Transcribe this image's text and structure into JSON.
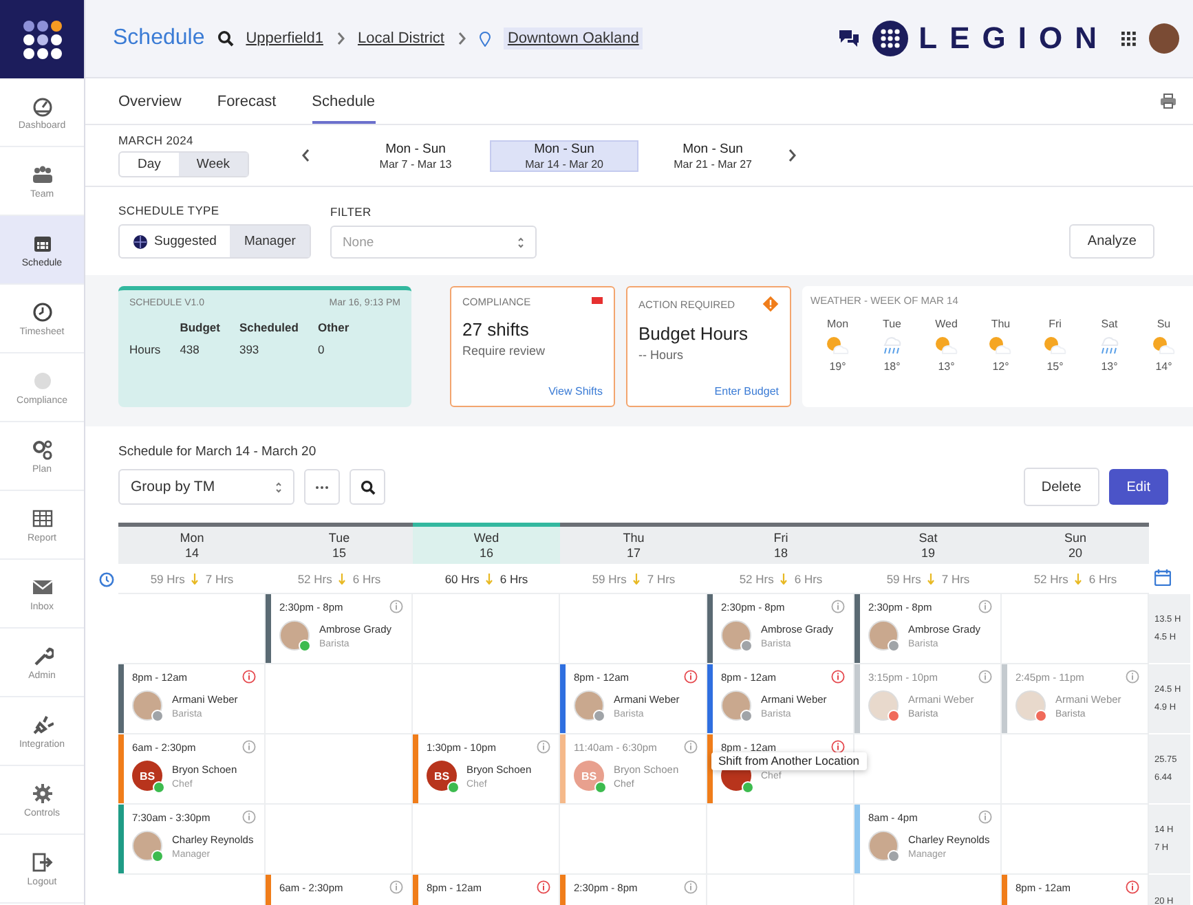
{
  "sidebar": {
    "items": [
      {
        "label": "Dashboard",
        "selected": false,
        "disabled": false
      },
      {
        "label": "Team",
        "selected": false,
        "disabled": false
      },
      {
        "label": "Schedule",
        "selected": true,
        "disabled": false
      },
      {
        "label": "Timesheet",
        "selected": false,
        "disabled": false
      },
      {
        "label": "Compliance",
        "selected": false,
        "disabled": true
      },
      {
        "label": "Plan",
        "selected": false,
        "disabled": false
      },
      {
        "label": "Report",
        "selected": false,
        "disabled": false
      },
      {
        "label": "Inbox",
        "selected": false,
        "disabled": false
      },
      {
        "label": "Admin",
        "selected": false,
        "disabled": false
      },
      {
        "label": "Integration",
        "selected": false,
        "disabled": false
      },
      {
        "label": "Controls",
        "selected": false,
        "disabled": false
      },
      {
        "label": "Logout",
        "selected": false,
        "disabled": false
      }
    ]
  },
  "topbar": {
    "title": "Schedule",
    "breadcrumbs": [
      "Upperfield1",
      "Local District",
      "Downtown Oakland"
    ],
    "logo": "LEGION"
  },
  "tabs": [
    {
      "label": "Overview",
      "selected": false
    },
    {
      "label": "Forecast",
      "selected": false
    },
    {
      "label": "Schedule",
      "selected": true
    }
  ],
  "period": {
    "label": "MARCH 2024",
    "views": [
      {
        "label": "Day",
        "selected": false
      },
      {
        "label": "Week",
        "selected": true
      }
    ],
    "weeks": [
      {
        "title": "Mon - Sun",
        "range": "Mar 7 - Mar 13",
        "selected": false
      },
      {
        "title": "Mon - Sun",
        "range": "Mar 14 - Mar 20",
        "selected": true
      },
      {
        "title": "Mon - Sun",
        "range": "Mar 21 - Mar 27",
        "selected": false
      }
    ]
  },
  "schedule_type": {
    "label": "SCHEDULE TYPE",
    "options": [
      {
        "label": "Suggested",
        "selected": false
      },
      {
        "label": "Manager",
        "selected": true
      }
    ]
  },
  "filter": {
    "label": "FILTER",
    "value": "None"
  },
  "analyze_button": "Analyze",
  "summary": {
    "title": "SCHEDULE V1.0",
    "timestamp": "Mar 16, 9:13 PM",
    "columns": [
      "Budget",
      "Scheduled",
      "Other"
    ],
    "row_label": "Hours",
    "values": [
      "438",
      "393",
      "0"
    ]
  },
  "compliance": {
    "label": "COMPLIANCE",
    "headline": "27 shifts",
    "detail": "Require review",
    "link": "View Shifts"
  },
  "action": {
    "label": "ACTION REQUIRED",
    "headline": "Budget Hours",
    "detail": "-- Hours",
    "link": "Enter Budget"
  },
  "weather": {
    "title": "WEATHER - WEEK OF MAR 14",
    "days": [
      {
        "day": "Mon",
        "kind": "sunny",
        "temp": "19°"
      },
      {
        "day": "Tue",
        "kind": "rain",
        "temp": "18°"
      },
      {
        "day": "Wed",
        "kind": "sunny",
        "temp": "13°"
      },
      {
        "day": "Thu",
        "kind": "sunny",
        "temp": "12°"
      },
      {
        "day": "Fri",
        "kind": "sunny",
        "temp": "15°"
      },
      {
        "day": "Sat",
        "kind": "rain",
        "temp": "13°"
      },
      {
        "day": "Su",
        "kind": "sunny",
        "temp": "14°"
      }
    ]
  },
  "schedule": {
    "title": "Schedule for March 14 - March 20",
    "group_by": "Group by TM",
    "delete_button": "Delete",
    "edit_button": "Edit",
    "days": [
      {
        "day": "Mon",
        "date": "14",
        "hours": "59 Hrs",
        "diff": "7 Hrs",
        "selected": false
      },
      {
        "day": "Tue",
        "date": "15",
        "hours": "52 Hrs",
        "diff": "6 Hrs",
        "selected": false
      },
      {
        "day": "Wed",
        "date": "16",
        "hours": "60 Hrs",
        "diff": "6 Hrs",
        "selected": true
      },
      {
        "day": "Thu",
        "date": "17",
        "hours": "59 Hrs",
        "diff": "7 Hrs",
        "selected": false
      },
      {
        "day": "Fri",
        "date": "18",
        "hours": "52 Hrs",
        "diff": "6 Hrs",
        "selected": false
      },
      {
        "day": "Sat",
        "date": "19",
        "hours": "59 Hrs",
        "diff": "7 Hrs",
        "selected": false
      },
      {
        "day": "Sun",
        "date": "20",
        "hours": "52 Hrs",
        "diff": "6 Hrs",
        "selected": false
      }
    ],
    "rows": [
      {
        "totals": [
          "13.5 H",
          "4.5 H"
        ],
        "cells": [
          {
            "kind": "empty"
          },
          {
            "kind": "shift",
            "time": "2:30pm - 8pm",
            "name": "Ambrose Grady",
            "role": "Barista",
            "monogram": false,
            "color": "#5a6a73",
            "status": {
              "color": "#3dbb4f"
            },
            "faded": false,
            "alert": false
          },
          {
            "kind": "empty"
          },
          {
            "kind": "empty"
          },
          {
            "kind": "shift",
            "time": "2:30pm - 8pm",
            "name": "Ambrose Grady",
            "role": "Barista",
            "monogram": false,
            "color": "#5a6a73",
            "status": {
              "color": "#a0a4a8"
            },
            "faded": false,
            "alert": false
          },
          {
            "kind": "shift",
            "time": "2:30pm - 8pm",
            "name": "Ambrose Grady",
            "role": "Barista",
            "monogram": false,
            "color": "#5a6a73",
            "status": {
              "color": "#a0a4a8"
            },
            "faded": false,
            "alert": false
          },
          {
            "kind": "empty"
          }
        ]
      },
      {
        "totals": [
          "24.5 H",
          "4.9 H"
        ],
        "cells": [
          {
            "kind": "shift",
            "time": "8pm - 12am",
            "name": "Armani Weber",
            "role": "Barista",
            "monogram": false,
            "color": "#5a6a73",
            "status": {
              "color": "#a0a4a8"
            },
            "faded": false,
            "alert": true
          },
          {
            "kind": "empty"
          },
          {
            "kind": "empty"
          },
          {
            "kind": "shift",
            "time": "8pm - 12am",
            "name": "Armani Weber",
            "role": "Barista",
            "monogram": false,
            "color": "#2f6fe0",
            "status": {
              "color": "#a0a4a8"
            },
            "faded": false,
            "alert": true
          },
          {
            "kind": "shift",
            "time": "8pm - 12am",
            "name": "Armani Weber",
            "role": "Barista",
            "monogram": false,
            "color": "#2f6fe0",
            "status": {
              "color": "#a0a4a8"
            },
            "faded": false,
            "alert": true
          },
          {
            "kind": "shift",
            "time": "3:15pm - 10pm",
            "name": "Armani Weber",
            "role": "Barista",
            "monogram": false,
            "color": "#c4cacf",
            "status": {
              "color": "#f06a5a"
            },
            "faded": true,
            "alert": false
          },
          {
            "kind": "shift",
            "time": "2:45pm - 11pm",
            "name": "Armani Weber",
            "role": "Barista",
            "monogram": false,
            "color": "#c4cacf",
            "status": {
              "color": "#f06a5a"
            },
            "faded": true,
            "alert": false
          }
        ]
      },
      {
        "totals": [
          "25.75",
          "6.44"
        ],
        "cells": [
          {
            "kind": "shift",
            "time": "6am - 2:30pm",
            "name": "Bryon Schoen",
            "role": "Chef",
            "monogram": true,
            "initials": "BS",
            "color": "#f07d1a",
            "status": {
              "color": "#3dbb4f"
            },
            "faded": false,
            "alert": false
          },
          {
            "kind": "empty"
          },
          {
            "kind": "shift",
            "time": "1:30pm - 10pm",
            "name": "Bryon Schoen",
            "role": "Chef",
            "monogram": true,
            "initials": "BS",
            "color": "#f07d1a",
            "status": {
              "color": "#3dbb4f"
            },
            "faded": false,
            "alert": false
          },
          {
            "kind": "shift",
            "time": "11:40am - 6:30pm",
            "name": "Bryon Schoen",
            "role": "Chef",
            "monogram": true,
            "initials": "BS",
            "color": "#f5b98a",
            "status": {
              "color": "#3dbb4f"
            },
            "faded": true,
            "alert": false
          },
          {
            "kind": "shift",
            "time": "8pm - 12am",
            "role": "Chef",
            "monogram": true,
            "color": "#f07d1a",
            "status": {
              "color": "#3dbb4f"
            },
            "faded": false,
            "alert": true,
            "tooltip": "Shift from Another Location"
          },
          {
            "kind": "empty"
          },
          {
            "kind": "empty"
          }
        ]
      },
      {
        "totals": [
          "14 H",
          "7 H"
        ],
        "cells": [
          {
            "kind": "shift",
            "time": "7:30am - 3:30pm",
            "name": "Charley Reynolds",
            "role": "Manager",
            "monogram": false,
            "color": "#1f9c86",
            "status": {
              "color": "#3dbb4f"
            },
            "faded": false,
            "alert": false
          },
          {
            "kind": "empty"
          },
          {
            "kind": "empty"
          },
          {
            "kind": "empty"
          },
          {
            "kind": "empty"
          },
          {
            "kind": "shift",
            "time": "8am - 4pm",
            "name": "Charley Reynolds",
            "role": "Manager",
            "monogram": false,
            "color": "#8ec5ef",
            "status": {
              "color": "#a0a4a8"
            },
            "faded": false,
            "alert": false
          },
          {
            "kind": "empty"
          }
        ]
      },
      {
        "totals": [
          "20 H"
        ],
        "cells": [
          {
            "kind": "empty"
          },
          {
            "kind": "shift",
            "time": "6am - 2:30pm",
            "color": "#f07d1a",
            "faded": false,
            "alert": false
          },
          {
            "kind": "shift",
            "time": "8pm - 12am",
            "color": "#f07d1a",
            "faded": false,
            "alert": true
          },
          {
            "kind": "shift",
            "time": "2:30pm - 8pm",
            "color": "#f07d1a",
            "faded": false,
            "alert": false
          },
          {
            "kind": "empty"
          },
          {
            "kind": "empty"
          },
          {
            "kind": "shift",
            "time": "8pm - 12am",
            "color": "#f07d1a",
            "faded": false,
            "alert": true
          }
        ]
      }
    ]
  }
}
